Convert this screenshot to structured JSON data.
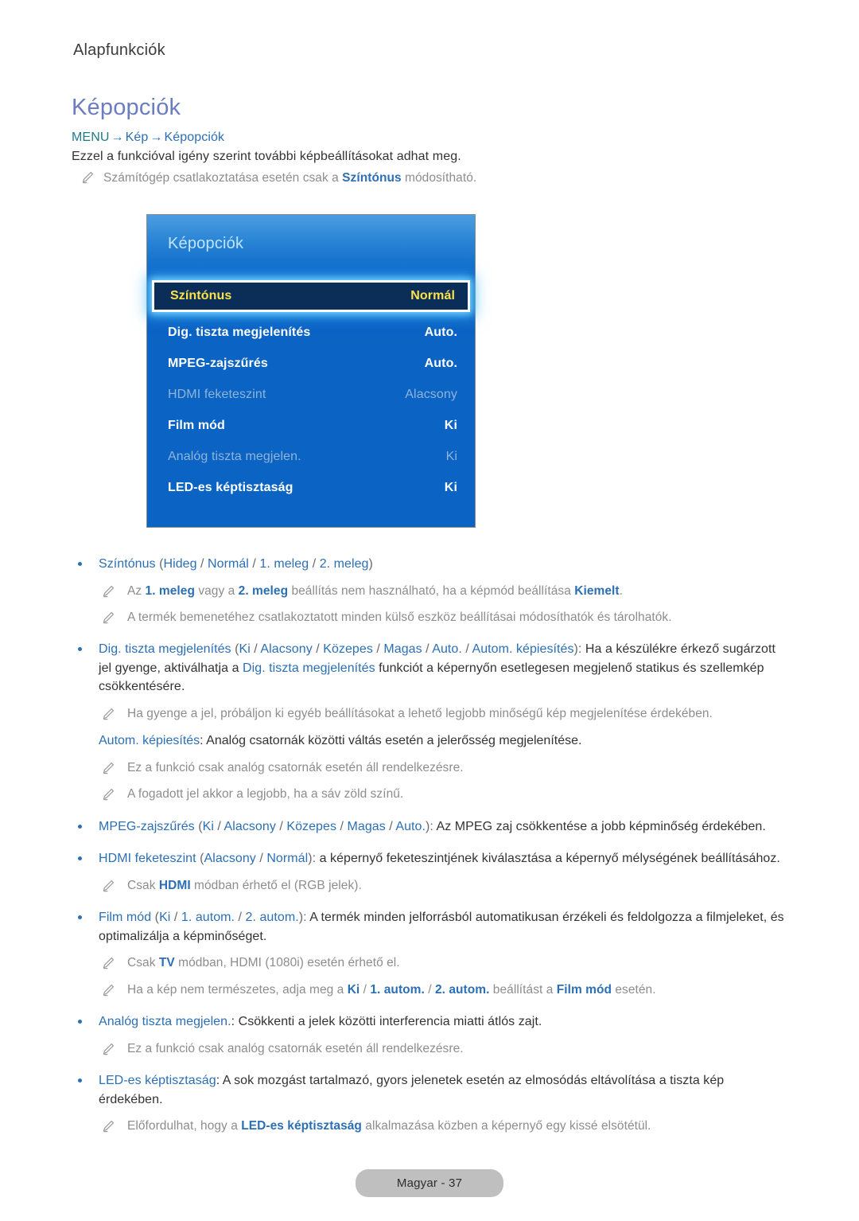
{
  "header": {
    "chapter": "Alapfunkciók",
    "heading": "Képopciók",
    "breadcrumb": {
      "menu": "MENU",
      "arrow": "→",
      "level1": "Kép",
      "level2": "Képopciók"
    },
    "lede": "Ezzel a funkcióval igény szerint további képbeállításokat adhat meg.",
    "note": {
      "pre": "Számítógép csatlakoztatása esetén csak a ",
      "hl": "Színtónus",
      "post": " módosítható."
    }
  },
  "osd": {
    "title": "Képopciók",
    "rows": [
      {
        "label": "Színtónus",
        "value": "Normál",
        "state": "selected"
      },
      {
        "label": "Dig. tiszta megjelenítés",
        "value": "Auto.",
        "state": "enabled"
      },
      {
        "label": "MPEG-zajszűrés",
        "value": "Auto.",
        "state": "enabled"
      },
      {
        "label": "HDMI feketeszint",
        "value": "Alacsony",
        "state": "disabled"
      },
      {
        "label": "Film mód",
        "value": "Ki",
        "state": "enabled"
      },
      {
        "label": "Analóg tiszta megjelen.",
        "value": "Ki",
        "state": "disabled"
      },
      {
        "label": "LED-es képtisztaság",
        "value": "Ki",
        "state": "enabled"
      }
    ]
  },
  "content": {
    "b1": {
      "name": "Színtónus",
      "opt_open": " (",
      "o1": "Hideg",
      "s1": " / ",
      "o2": "Normál",
      "s2": " / ",
      "o3": "1. meleg",
      "s3": " / ",
      "o4": "2. meleg",
      "opt_close": ")"
    },
    "b1n1": {
      "p1": "Az ",
      "h1": "1. meleg",
      "p2": " vagy a ",
      "h2": "2. meleg",
      "p3": " beállítás nem használható, ha a képmód beállítása ",
      "h3": "Kiemelt",
      "p4": "."
    },
    "b1n2": "A termék bemenetéhez csatlakoztatott minden külső eszköz beállításai módosíthatók és tárolhatók.",
    "b2": {
      "name": "Dig. tiszta megjelenítés",
      "opt_open": " (",
      "o1": "Ki",
      "s1": " / ",
      "o2": "Alacsony",
      "s2": " / ",
      "o3": "Közepes",
      "s3": " / ",
      "o4": "Magas",
      "s4": " / ",
      "o5": "Auto.",
      "s5": " / ",
      "o6": "Autom. képiesítés",
      "opt_close": "): ",
      "t1": "Ha a készülékre érkező sugárzott jel gyenge, aktiválhatja a ",
      "h1": "Dig. tiszta megjelenítés",
      "t2": " funkciót a képernyőn esetlegesen megjelenő statikus és szellemkép csökkentésére."
    },
    "b2n1": "Ha gyenge a jel, próbáljon ki egyéb beállításokat a lehető legjobb minőségű kép megjelenítése érdekében.",
    "b2p1": {
      "h": "Autom. képiesítés",
      "t": ": Analóg csatornák közötti váltás esetén a jelerősség megjelenítése."
    },
    "b2n2": "Ez a funkció csak analóg csatornák esetén áll rendelkezésre.",
    "b2n3": "A fogadott jel akkor a legjobb, ha a sáv zöld színű.",
    "b3": {
      "name": "MPEG-zajszűrés",
      "opt_open": " (",
      "o1": "Ki",
      "s1": " / ",
      "o2": "Alacsony",
      "s2": " / ",
      "o3": "Közepes",
      "s3": " / ",
      "o4": "Magas",
      "s4": " / ",
      "o5": "Auto.",
      "opt_close": "): ",
      "t1": "Az MPEG zaj csökkentése a jobb képminőség érdekében."
    },
    "b4": {
      "name": "HDMI feketeszint",
      "opt_open": " (",
      "o1": "Alacsony",
      "s1": " / ",
      "o2": "Normál",
      "opt_close": "): ",
      "t1": "a képernyő feketeszintjének kiválasztása a képernyő mélységének beállításához."
    },
    "b4n1": {
      "p1": "Csak ",
      "h1": "HDMI",
      "p2": " módban érhető el (RGB jelek)."
    },
    "b5": {
      "name": "Film mód",
      "opt_open": " (",
      "o1": "Ki",
      "s1": " / ",
      "o2": "1. autom.",
      "s2": " / ",
      "o3": "2. autom.",
      "opt_close": "): ",
      "t1": "A termék minden jelforrásból automatikusan érzékeli és feldolgozza a filmjeleket, és optimalizálja a képminőséget."
    },
    "b5n1": {
      "p1": "Csak ",
      "h1": "TV",
      "p2": " módban, HDMI (1080i) esetén érhető el."
    },
    "b5n2": {
      "p1": "Ha a kép nem természetes, adja meg a ",
      "h1": "Ki",
      "s1": " / ",
      "h2": "1. autom.",
      "s2": " / ",
      "h3": "2. autom.",
      "p2": " beállítást a ",
      "h4": "Film mód",
      "p3": " esetén."
    },
    "b6": {
      "name": "Analóg tiszta megjelen.",
      "t1": ": Csökkenti a jelek közötti interferencia miatti átlós zajt."
    },
    "b6n1": "Ez a funkció csak analóg csatornák esetén áll rendelkezésre.",
    "b7": {
      "name": "LED-es képtisztaság",
      "t1": ": A sok mozgást tartalmazó, gyors jelenetek esetén az elmosódás eltávolítása a tiszta kép érdekében."
    },
    "b7n1": {
      "p1": "Előfordulhat, hogy a ",
      "h1": "LED-es képtisztaság",
      "p2": " alkalmazása közben a képernyő egy kissé elsötétül."
    }
  },
  "footer": {
    "label": "Magyar - 37"
  },
  "colors": {
    "heading": "#6b7cc0",
    "link": "#2c6fb5",
    "menu_teal": "#1f7a8c",
    "note_grey": "#8d8d8d",
    "osd_blue": "#0b63c4",
    "osd_selected_bg": "#0b2e58",
    "osd_selected_text": "#ffe24a",
    "osd_disabled": "#8fb4da",
    "footer_pill": "#bfbfbf"
  }
}
